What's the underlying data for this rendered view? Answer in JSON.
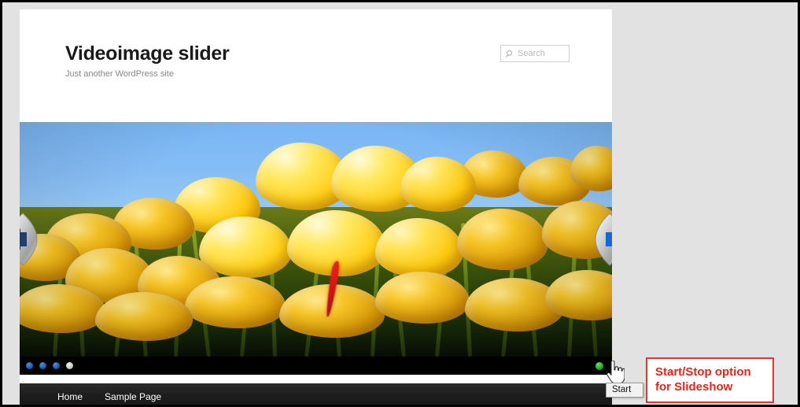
{
  "site": {
    "title": "Videoimage slider",
    "tagline": "Just another WordPress site"
  },
  "search": {
    "placeholder": "Search",
    "value": "",
    "icon": "search-icon"
  },
  "slider": {
    "prev_icon": "arrow-left-icon",
    "next_icon": "arrow-right-icon",
    "slide_alt": "Field of yellow tulips against blue sky",
    "dots": [
      {
        "label": "1",
        "active": false
      },
      {
        "label": "2",
        "active": false
      },
      {
        "label": "3",
        "active": false
      },
      {
        "label": "4",
        "active": true
      }
    ],
    "play_control": {
      "name": "start-stop-dot",
      "state": "start",
      "color": "#22ad22"
    }
  },
  "tooltip": {
    "text": "Start"
  },
  "nav": {
    "items": [
      {
        "label": "Home"
      },
      {
        "label": "Sample Page"
      }
    ]
  },
  "annotation": {
    "line1": "Start/Stop option",
    "line2": "for Slideshow",
    "color": "#e8231c"
  },
  "colors": {
    "frame_border": "#000000",
    "page_background": "#e2e2e2",
    "site_background": "#ffffff",
    "nav_background": "#1d1d1d",
    "control_bar": "#000000",
    "dot_active": "#c9c9c9",
    "dot_inactive": "#1d62b3"
  }
}
